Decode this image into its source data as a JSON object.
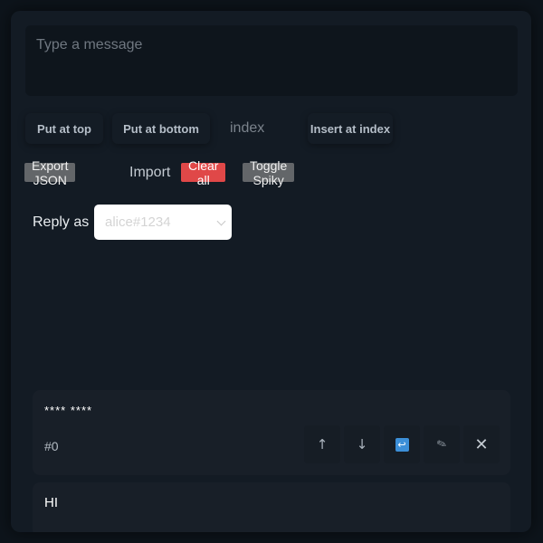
{
  "composer": {
    "placeholder": "Type a message"
  },
  "toolbar": {
    "put_top_label": "Put at top",
    "put_bottom_label": "Put at bottom",
    "index_placeholder": "index",
    "insert_label": "Insert at index"
  },
  "actions": {
    "export_label": "Export JSON",
    "import_label": "Import",
    "clear_label": "Clear all",
    "spiky_label": "Toggle Spiky"
  },
  "reply": {
    "label": "Reply as",
    "selected": "alice#1234"
  },
  "messages": [
    {
      "text": "**** ****",
      "index": "#0"
    },
    {
      "text": "HI"
    }
  ],
  "message_actions": {
    "up_icon": "↑",
    "down_icon": "↓",
    "reply_icon": "↩",
    "edit_icon": "✎",
    "delete_icon": "✕"
  },
  "colors": {
    "background": "#0d141b",
    "panel": "#131b24",
    "danger": "#e04848",
    "neutral_button": "#636669",
    "reply_icon": "#3c8fd8"
  }
}
